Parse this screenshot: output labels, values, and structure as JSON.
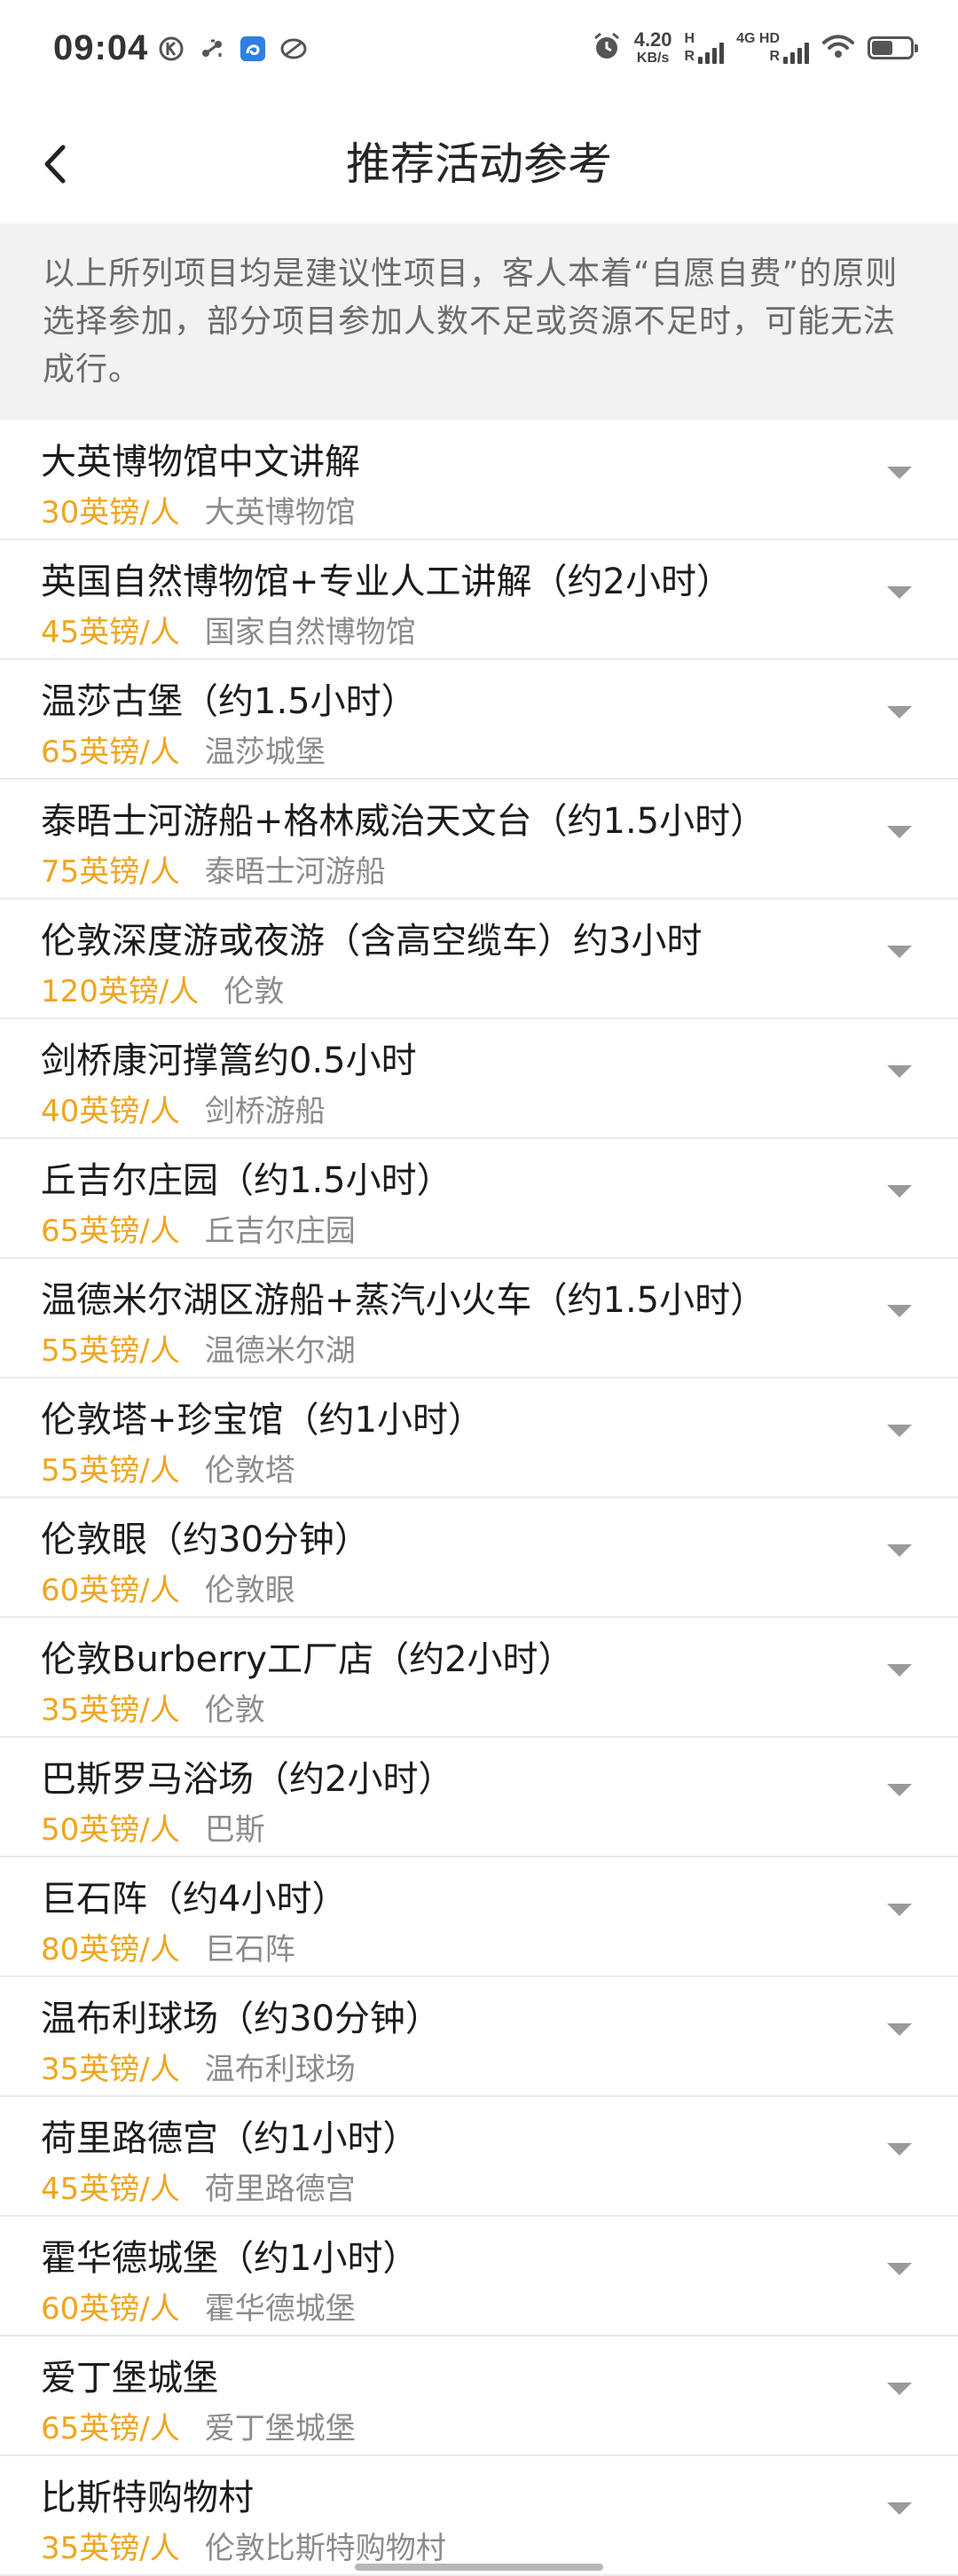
{
  "status_bar": {
    "time": "09:04",
    "net_speed_value": "4.20",
    "net_speed_unit": "KB/s",
    "sim1_label": "H",
    "sim1_sub": "R",
    "sim2_label": "4G HD",
    "sim2_sub": "R",
    "battery_level_percent": 55,
    "icons": [
      "k-circle-icon",
      "connection-icon",
      "app-badge-icon",
      "sync-icon",
      "alarm-icon",
      "wifi-icon",
      "battery-icon"
    ]
  },
  "header": {
    "title": "推荐活动参考",
    "back_icon": "chevron-left-icon"
  },
  "notice": {
    "text": "以上所列项目均是建议性项目，客人本着“自愿自费”的原则选择参加，部分项目参加人数不足或资源不足时，可能无法成行。"
  },
  "colors": {
    "price": "#f0a51e",
    "location": "#8c8c8c",
    "notice_bg": "#f2f2f2"
  },
  "activities": [
    {
      "name": "大英博物馆中文讲解",
      "price": "30英镑/人",
      "location": "大英博物馆"
    },
    {
      "name": "英国自然博物馆+专业人工讲解（约2小时）",
      "price": "45英镑/人",
      "location": "国家自然博物馆"
    },
    {
      "name": "温莎古堡（约1.5小时）",
      "price": "65英镑/人",
      "location": "温莎城堡"
    },
    {
      "name": "泰晤士河游船+格林威治天文台（约1.5小时）",
      "price": "75英镑/人",
      "location": "泰晤士河游船"
    },
    {
      "name": "伦敦深度游或夜游（含高空缆车）约3小时",
      "price": "120英镑/人",
      "location": "伦敦"
    },
    {
      "name": "剑桥康河撑篙约0.5小时",
      "price": "40英镑/人",
      "location": "剑桥游船"
    },
    {
      "name": "丘吉尔庄园（约1.5小时）",
      "price": "65英镑/人",
      "location": "丘吉尔庄园"
    },
    {
      "name": "温德米尔湖区游船+蒸汽小火车（约1.5小时）",
      "price": "55英镑/人",
      "location": "温德米尔湖"
    },
    {
      "name": "伦敦塔+珍宝馆（约1小时）",
      "price": "55英镑/人",
      "location": "伦敦塔"
    },
    {
      "name": "伦敦眼（约30分钟）",
      "price": "60英镑/人",
      "location": "伦敦眼"
    },
    {
      "name": "伦敦Burberry工厂店（约2小时）",
      "price": "35英镑/人",
      "location": "伦敦"
    },
    {
      "name": "巴斯罗马浴场（约2小时）",
      "price": "50英镑/人",
      "location": "巴斯"
    },
    {
      "name": "巨石阵（约4小时）",
      "price": "80英镑/人",
      "location": "巨石阵"
    },
    {
      "name": "温布利球场（约30分钟）",
      "price": "35英镑/人",
      "location": "温布利球场"
    },
    {
      "name": "荷里路德宫（约1小时）",
      "price": "45英镑/人",
      "location": "荷里路德宫"
    },
    {
      "name": "霍华德城堡（约1小时）",
      "price": "60英镑/人",
      "location": "霍华德城堡"
    },
    {
      "name": "爱丁堡城堡",
      "price": "65英镑/人",
      "location": "爱丁堡城堡"
    },
    {
      "name": "比斯特购物村",
      "price": "35英镑/人",
      "location": "伦敦比斯特购物村"
    }
  ]
}
